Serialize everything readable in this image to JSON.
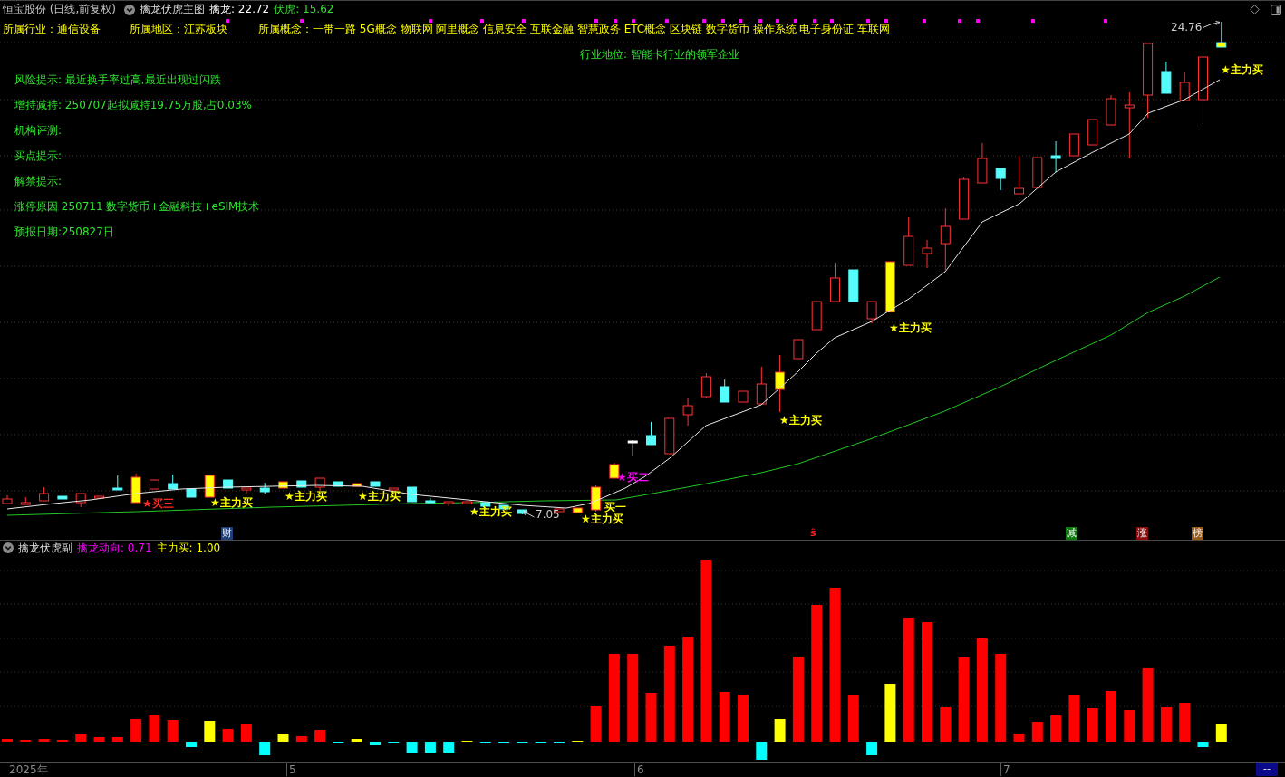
{
  "header": {
    "title": "恒宝股份 (日线,前复权)",
    "indicator": "擒龙伏虎主图",
    "readings": [
      {
        "text": "擒龙: 22.72",
        "color": "#ffffff"
      },
      {
        "text": "伏虎: 15.62",
        "color": "#33dd33"
      }
    ]
  },
  "profile": {
    "industry": "所属行业：通信设备",
    "region": "所属地区：江苏板块",
    "concepts_label": "所属概念：",
    "concepts": [
      "一带一路",
      "5G概念",
      "物联网",
      "阿里概念",
      "信息安全",
      "互联金融",
      "智慧政务",
      "ETC概念",
      "区块链",
      "数字货币",
      "操作系统",
      "电子身份证",
      "车联网"
    ]
  },
  "industry_position": "行业地位: 智能卡行业的领军企业",
  "notes": [
    "风险提示: 最近换手率过高,最近出现过闪跌",
    "增持减持: 250707起拟减持19.75万股,占0.03%",
    "机构评测:",
    "买点提示:",
    "解禁提示:",
    "涨停原因 250711 数字货币+金融科技+eSIM技术",
    "预报日期:250827日"
  ],
  "main_chart": {
    "annotations": [
      {
        "text": "★买三",
        "color": "#ff2a2a"
      },
      {
        "text": "★主力买",
        "color": "#ffff00"
      },
      {
        "text": "★主力买",
        "color": "#ffff00"
      },
      {
        "text": "★主力买",
        "color": "#ffff00"
      },
      {
        "text": "★主力买",
        "color": "#ffff00"
      },
      {
        "text": "★主力买",
        "color": "#ffff00"
      },
      {
        "text": "★买二",
        "color": "#ff00ff"
      },
      {
        "text": "买一",
        "color": "#ffff00"
      },
      {
        "text": "★主力买",
        "color": "#ffff00"
      },
      {
        "text": "★主力买",
        "color": "#ffff00"
      },
      {
        "text": "★主力买",
        "color": "#ffff00"
      }
    ],
    "high_label": "24.76",
    "low_label": "7.05",
    "events": [
      {
        "text": "财",
        "kind": "boxed",
        "color": "#1f3f78"
      },
      {
        "text": "ŝ",
        "kind": "plain",
        "color": "#ff2020"
      },
      {
        "text": "减",
        "kind": "boxed",
        "color": "#0c7a0c"
      },
      {
        "text": "涨",
        "kind": "boxed",
        "color": "#8a0c0c"
      },
      {
        "text": "榜",
        "kind": "boxed",
        "color": "#9a5a14"
      }
    ]
  },
  "sub_header": {
    "title": "擒龙伏虎副",
    "readings": [
      {
        "text": "擒龙动向: 0.71",
        "color": "#ff00ff"
      },
      {
        "text": "主力买: 1.00",
        "color": "#ffff00"
      }
    ]
  },
  "axis": {
    "labels": [
      "2025年",
      "5",
      "6",
      "7"
    ],
    "corner": "--"
  }
}
